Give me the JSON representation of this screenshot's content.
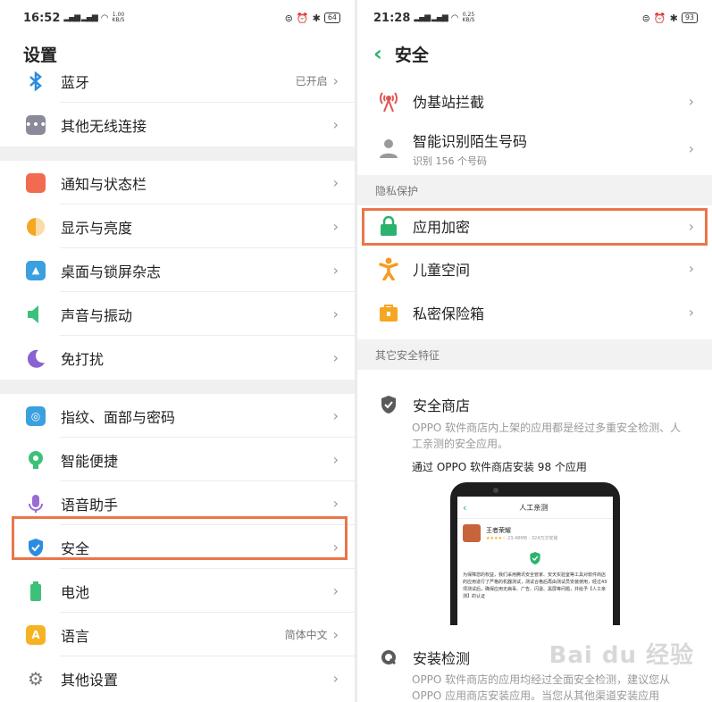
{
  "left": {
    "status": {
      "time": "16:52",
      "signal": "ℳ ⅈ ℳ ⅈ",
      "speed_value": "1.00",
      "speed_unit": "KB/S",
      "battery": "64"
    },
    "title": "设置",
    "items": [
      {
        "label": "蓝牙",
        "value": "已开启",
        "icon": "bluetooth-icon"
      },
      {
        "label": "其他无线连接",
        "value": "",
        "icon": "more-dots-icon"
      },
      {
        "label": "通知与状态栏",
        "value": "",
        "icon": "notification-icon"
      },
      {
        "label": "显示与亮度",
        "value": "",
        "icon": "brightness-icon"
      },
      {
        "label": "桌面与锁屏杂志",
        "value": "",
        "icon": "wallpaper-icon"
      },
      {
        "label": "声音与振动",
        "value": "",
        "icon": "sound-icon"
      },
      {
        "label": "免打扰",
        "value": "",
        "icon": "moon-icon"
      },
      {
        "label": "指纹、面部与密码",
        "value": "",
        "icon": "fingerprint-icon"
      },
      {
        "label": "智能便捷",
        "value": "",
        "icon": "smart-icon"
      },
      {
        "label": "语音助手",
        "value": "",
        "icon": "microphone-icon"
      },
      {
        "label": "安全",
        "value": "",
        "icon": "shield-icon"
      },
      {
        "label": "电池",
        "value": "",
        "icon": "battery-icon"
      },
      {
        "label": "语言",
        "value": "简体中文",
        "icon": "language-icon"
      },
      {
        "label": "其他设置",
        "value": "",
        "icon": "gear-icon"
      }
    ]
  },
  "right": {
    "status": {
      "time": "21:28",
      "signal": "ℳ ⅈ ℳ ⅈ",
      "speed_value": "0.25",
      "speed_unit": "KB/S",
      "battery": "93"
    },
    "title": "安全",
    "top_items": [
      {
        "label": "伪基站拦截",
        "sub": "",
        "icon": "antenna-icon"
      },
      {
        "label": "智能识别陌生号码",
        "sub": "识别 156 个号码",
        "icon": "person-icon"
      }
    ],
    "privacy_header": "隐私保护",
    "privacy_items": [
      {
        "label": "应用加密",
        "icon": "lock-icon"
      },
      {
        "label": "儿童空间",
        "icon": "child-icon"
      },
      {
        "label": "私密保险箱",
        "icon": "safe-icon"
      }
    ],
    "other_header": "其它安全特征",
    "store": {
      "label": "安全商店",
      "desc": "OPPO 软件商店内上架的应用都是经过多重安全检测、人工亲测的安全应用。",
      "note": "通过 OPPO 软件商店安装 98 个应用",
      "phone_title": "人工亲测",
      "phone_app": "王者荣耀",
      "phone_meta": "23.48MB · 324万次安装",
      "phone_text": "为保障您的权益，我们采用腾讯安全管家、安天实验室等工具对软件商店的应用进行了严格的机器测试，测试合格后再由测试员安装使用，经过43项测试后，确保应用无病毒、广告、闪退、黑屏等问题，并给予【人工亲测】的认证"
    },
    "install": {
      "label": "安装检测",
      "desc": "OPPO 软件商店的应用均经过全面安全检测，建议您从 OPPO 应用商店安装应用。当您从其他渠道安装应用"
    },
    "watermark": "Bai du 经验"
  },
  "colors": {
    "highlight": "#e9764a",
    "accent": "#2bb36e"
  }
}
